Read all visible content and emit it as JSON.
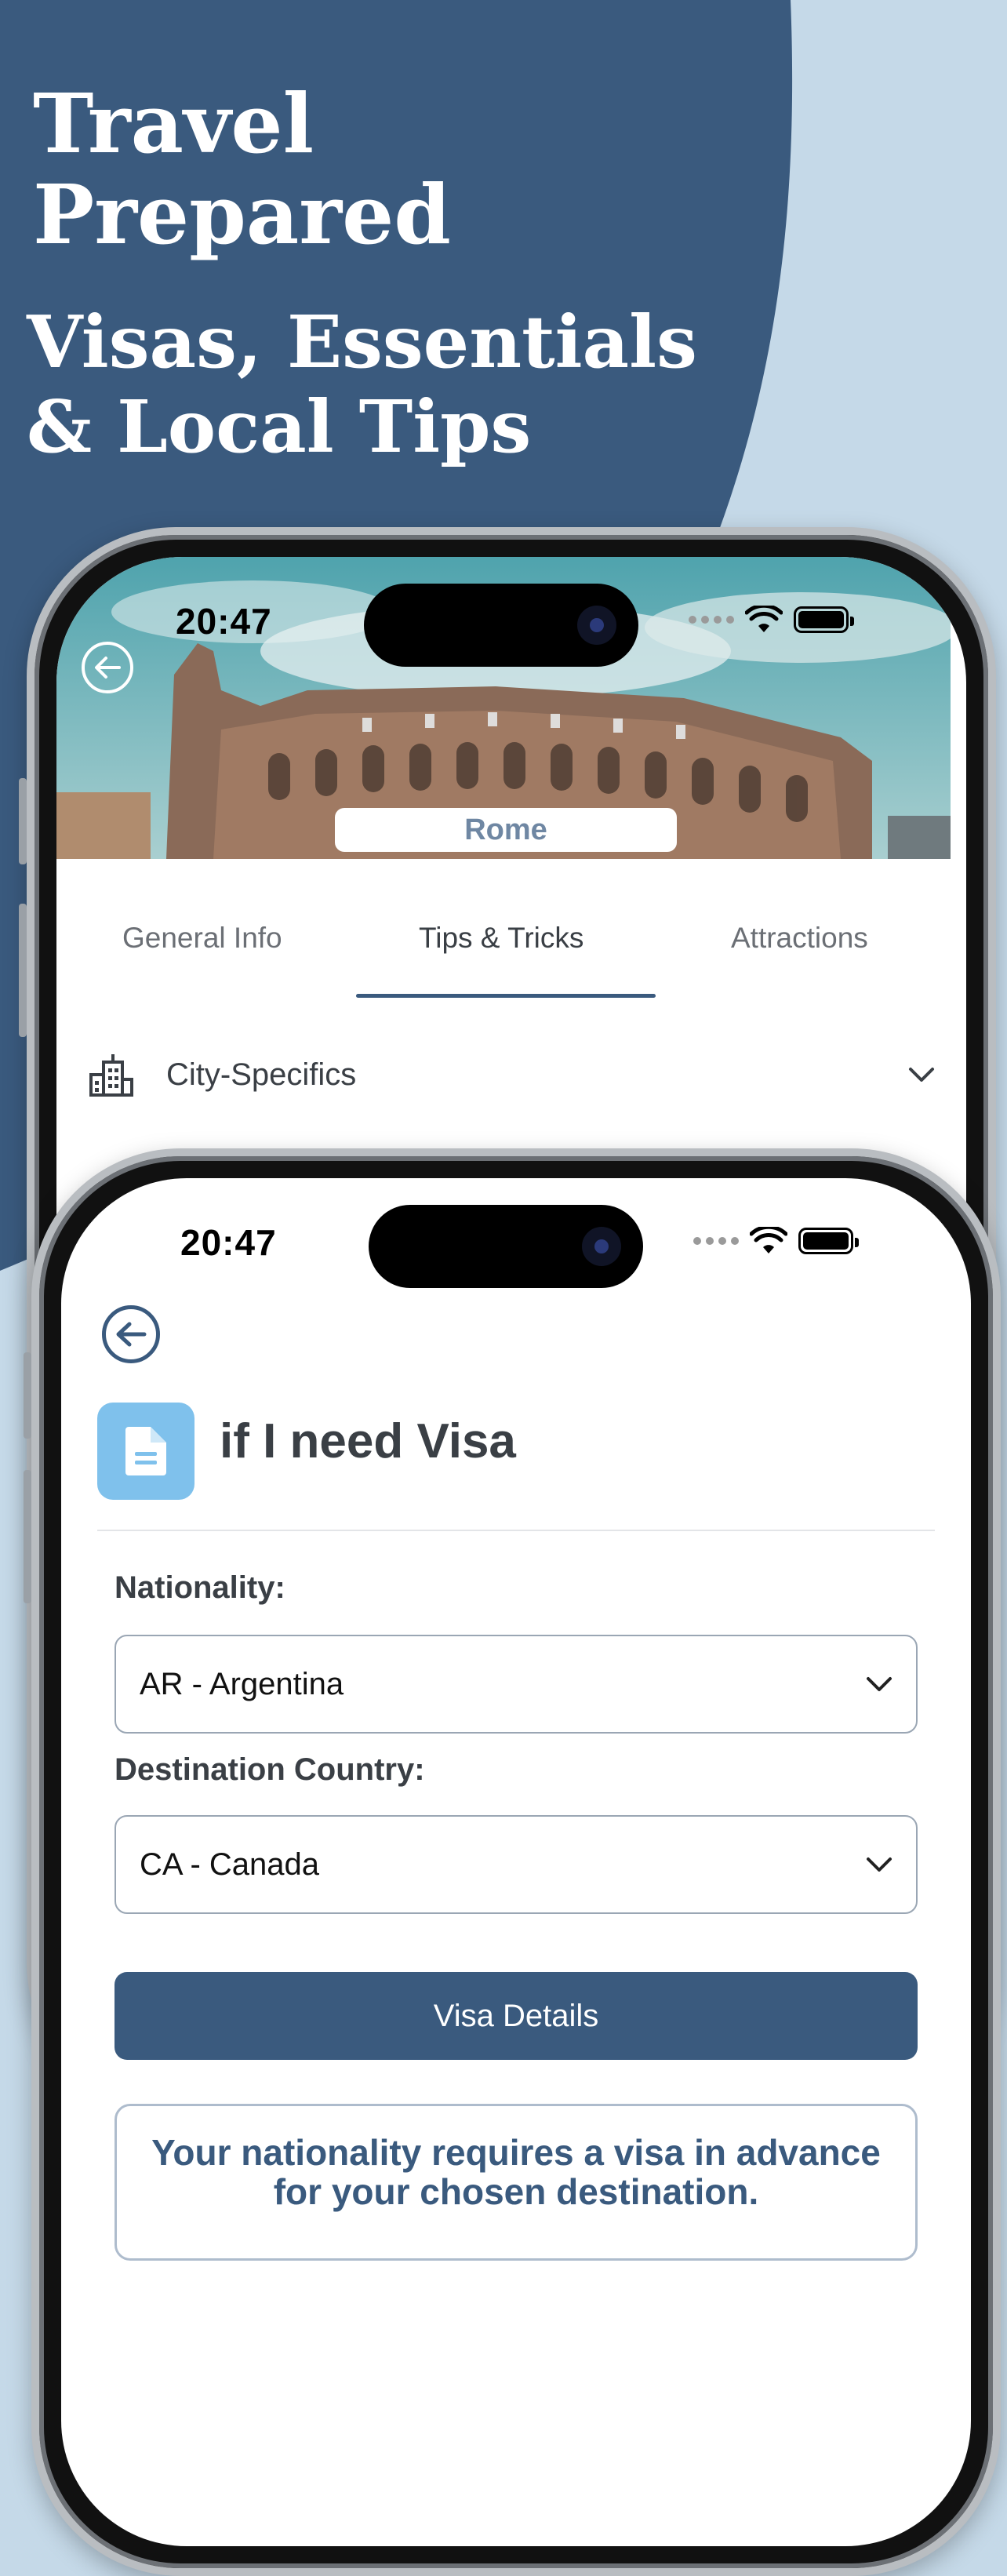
{
  "promo": {
    "headline": "Travel Prepared",
    "subline": "Visas, Essentials & Local Tips"
  },
  "colors": {
    "navy": "#3a5a7e",
    "background": "#c5d9e8",
    "tile": "#7fc1ec"
  },
  "phone_city": {
    "time": "20:47",
    "city": "Rome",
    "tabs": [
      {
        "label": "General Info",
        "active": false
      },
      {
        "label": "Tips & Tricks",
        "active": true
      },
      {
        "label": "Attractions",
        "active": false
      }
    ],
    "section": {
      "label": "City-Specifics",
      "icon": "city-building-icon"
    }
  },
  "phone_visa": {
    "time": "20:47",
    "title": "if I need Visa",
    "icon": "document-icon",
    "nationality_label": "Nationality:",
    "nationality_value": "AR - Argentina",
    "destination_label": "Destination Country:",
    "destination_value": "CA - Canada",
    "button_label": "Visa Details",
    "result_text": "Your nationality requires a visa in advance for your chosen destination."
  }
}
